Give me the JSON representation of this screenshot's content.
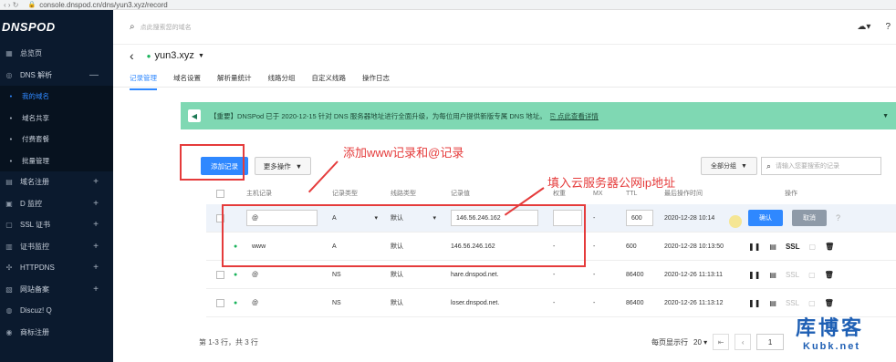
{
  "browser": {
    "url": "console.dnspod.cn/dns/yun3.xyz/record"
  },
  "sidebar": {
    "logo": "DNSPOD",
    "items": [
      {
        "label": "总览页",
        "icon": "grid-icon"
      },
      {
        "label": "DNS 解析",
        "icon": "globe-icon",
        "toggle": "—"
      }
    ],
    "subitems": [
      {
        "label": "我的域名",
        "active": true
      },
      {
        "label": "域名共享"
      },
      {
        "label": "付费套餐"
      },
      {
        "label": "批量管理"
      }
    ],
    "more": [
      {
        "label": "域名注册",
        "icon": "domain-icon"
      },
      {
        "label": "D 监控",
        "icon": "monitor-icon"
      },
      {
        "label": "SSL 证书",
        "icon": "ssl-icon"
      },
      {
        "label": "证书监控",
        "icon": "cert-icon"
      },
      {
        "label": "HTTPDNS",
        "icon": "httpdns-icon"
      },
      {
        "label": "网站备案",
        "icon": "record-icon"
      },
      {
        "label": "Discuz! Q",
        "icon": "discuz-icon"
      },
      {
        "label": "商标注册",
        "icon": "trademark-icon"
      }
    ]
  },
  "topbar": {
    "search_placeholder": "点此搜索您的域名"
  },
  "domain": {
    "name": "yun3.xyz"
  },
  "tabs": [
    "记录管理",
    "域名设置",
    "解析量统计",
    "线路分组",
    "自定义线路",
    "操作日志"
  ],
  "notice": {
    "text": "【重要】DNSPod 已于 2020-12-15 针对 DNS 服务器地址进行全面升级，为每位用户提供新版专属 DNS 地址。",
    "link": "点此查看详情"
  },
  "toolbar": {
    "add_label": "添加记录",
    "more_label": "更多操作",
    "group_label": "全部分组",
    "search_placeholder": "请输入您要搜索的记录"
  },
  "annotations": {
    "add_hint": "添加www记录和@记录",
    "ip_hint": "填入云服务器公网ip地址"
  },
  "table": {
    "headers": [
      "主机记录",
      "记录类型",
      "线路类型",
      "记录值",
      "权重",
      "MX",
      "TTL",
      "最后操作时间",
      "操作"
    ],
    "edit_row": {
      "host": "@",
      "type": "A",
      "line": "默认",
      "value": "146.56.246.162",
      "weight": "",
      "mx": "-",
      "ttl": "600",
      "time": "2020-12-28 10:14",
      "ok": "确认",
      "cancel": "取消"
    },
    "rows": [
      {
        "host": "www",
        "type": "A",
        "line": "默认",
        "value": "146.56.246.162",
        "weight": "-",
        "mx": "-",
        "ttl": "600",
        "time": "2020-12-28 10:13:50",
        "ssl": "SSL"
      },
      {
        "host": "@",
        "type": "NS",
        "line": "默认",
        "value": "hare.dnspod.net.",
        "weight": "-",
        "mx": "-",
        "ttl": "86400",
        "time": "2020-12-26 11:13:11",
        "ssl": "SSL"
      },
      {
        "host": "@",
        "type": "NS",
        "line": "默认",
        "value": "loser.dnspod.net.",
        "weight": "-",
        "mx": "-",
        "ttl": "86400",
        "time": "2020-12-26 11:13:12",
        "ssl": "SSL"
      }
    ]
  },
  "footer": {
    "summary": "第 1-3 行，共 3 行",
    "per_page_label": "每页显示行",
    "per_page": "20",
    "page": "1"
  },
  "watermark": {
    "line1": "库博客",
    "line2": "Kubk.net"
  }
}
